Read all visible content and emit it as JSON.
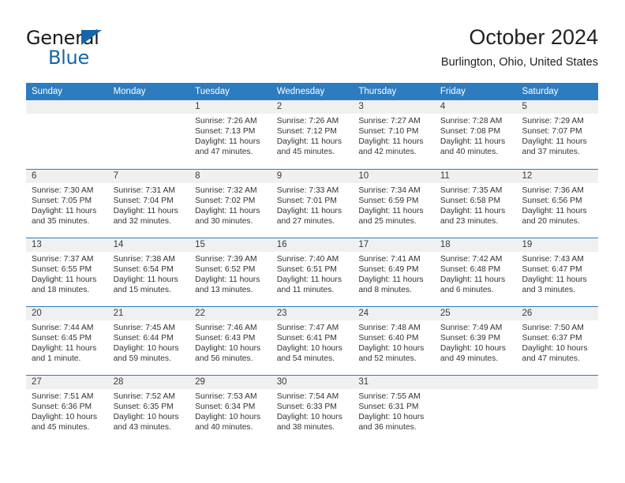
{
  "brand": {
    "name_part1": "General",
    "name_part2": "Blue",
    "triangle_color": "#1565aa"
  },
  "header": {
    "title": "October 2024",
    "subtitle": "Burlington, Ohio, United States"
  },
  "theme": {
    "header_blue": "#2d7cc0",
    "day_band_gray": "#f0f0f0",
    "text": "#333333"
  },
  "weekdays": [
    "Sunday",
    "Monday",
    "Tuesday",
    "Wednesday",
    "Thursday",
    "Friday",
    "Saturday"
  ],
  "labels": {
    "sunrise_prefix": "Sunrise: ",
    "sunset_prefix": "Sunset: ",
    "daylight_prefix": "Daylight: "
  },
  "weeks": [
    [
      {
        "day": "",
        "sunrise": "",
        "sunset": "",
        "daylight": "",
        "empty": true
      },
      {
        "day": "",
        "sunrise": "",
        "sunset": "",
        "daylight": "",
        "empty": true
      },
      {
        "day": "1",
        "sunrise": "Sunrise: 7:26 AM",
        "sunset": "Sunset: 7:13 PM",
        "daylight": "Daylight: 11 hours and 47 minutes."
      },
      {
        "day": "2",
        "sunrise": "Sunrise: 7:26 AM",
        "sunset": "Sunset: 7:12 PM",
        "daylight": "Daylight: 11 hours and 45 minutes."
      },
      {
        "day": "3",
        "sunrise": "Sunrise: 7:27 AM",
        "sunset": "Sunset: 7:10 PM",
        "daylight": "Daylight: 11 hours and 42 minutes."
      },
      {
        "day": "4",
        "sunrise": "Sunrise: 7:28 AM",
        "sunset": "Sunset: 7:08 PM",
        "daylight": "Daylight: 11 hours and 40 minutes."
      },
      {
        "day": "5",
        "sunrise": "Sunrise: 7:29 AM",
        "sunset": "Sunset: 7:07 PM",
        "daylight": "Daylight: 11 hours and 37 minutes."
      }
    ],
    [
      {
        "day": "6",
        "sunrise": "Sunrise: 7:30 AM",
        "sunset": "Sunset: 7:05 PM",
        "daylight": "Daylight: 11 hours and 35 minutes."
      },
      {
        "day": "7",
        "sunrise": "Sunrise: 7:31 AM",
        "sunset": "Sunset: 7:04 PM",
        "daylight": "Daylight: 11 hours and 32 minutes."
      },
      {
        "day": "8",
        "sunrise": "Sunrise: 7:32 AM",
        "sunset": "Sunset: 7:02 PM",
        "daylight": "Daylight: 11 hours and 30 minutes."
      },
      {
        "day": "9",
        "sunrise": "Sunrise: 7:33 AM",
        "sunset": "Sunset: 7:01 PM",
        "daylight": "Daylight: 11 hours and 27 minutes."
      },
      {
        "day": "10",
        "sunrise": "Sunrise: 7:34 AM",
        "sunset": "Sunset: 6:59 PM",
        "daylight": "Daylight: 11 hours and 25 minutes."
      },
      {
        "day": "11",
        "sunrise": "Sunrise: 7:35 AM",
        "sunset": "Sunset: 6:58 PM",
        "daylight": "Daylight: 11 hours and 23 minutes."
      },
      {
        "day": "12",
        "sunrise": "Sunrise: 7:36 AM",
        "sunset": "Sunset: 6:56 PM",
        "daylight": "Daylight: 11 hours and 20 minutes."
      }
    ],
    [
      {
        "day": "13",
        "sunrise": "Sunrise: 7:37 AM",
        "sunset": "Sunset: 6:55 PM",
        "daylight": "Daylight: 11 hours and 18 minutes."
      },
      {
        "day": "14",
        "sunrise": "Sunrise: 7:38 AM",
        "sunset": "Sunset: 6:54 PM",
        "daylight": "Daylight: 11 hours and 15 minutes."
      },
      {
        "day": "15",
        "sunrise": "Sunrise: 7:39 AM",
        "sunset": "Sunset: 6:52 PM",
        "daylight": "Daylight: 11 hours and 13 minutes."
      },
      {
        "day": "16",
        "sunrise": "Sunrise: 7:40 AM",
        "sunset": "Sunset: 6:51 PM",
        "daylight": "Daylight: 11 hours and 11 minutes."
      },
      {
        "day": "17",
        "sunrise": "Sunrise: 7:41 AM",
        "sunset": "Sunset: 6:49 PM",
        "daylight": "Daylight: 11 hours and 8 minutes."
      },
      {
        "day": "18",
        "sunrise": "Sunrise: 7:42 AM",
        "sunset": "Sunset: 6:48 PM",
        "daylight": "Daylight: 11 hours and 6 minutes."
      },
      {
        "day": "19",
        "sunrise": "Sunrise: 7:43 AM",
        "sunset": "Sunset: 6:47 PM",
        "daylight": "Daylight: 11 hours and 3 minutes."
      }
    ],
    [
      {
        "day": "20",
        "sunrise": "Sunrise: 7:44 AM",
        "sunset": "Sunset: 6:45 PM",
        "daylight": "Daylight: 11 hours and 1 minute."
      },
      {
        "day": "21",
        "sunrise": "Sunrise: 7:45 AM",
        "sunset": "Sunset: 6:44 PM",
        "daylight": "Daylight: 10 hours and 59 minutes."
      },
      {
        "day": "22",
        "sunrise": "Sunrise: 7:46 AM",
        "sunset": "Sunset: 6:43 PM",
        "daylight": "Daylight: 10 hours and 56 minutes."
      },
      {
        "day": "23",
        "sunrise": "Sunrise: 7:47 AM",
        "sunset": "Sunset: 6:41 PM",
        "daylight": "Daylight: 10 hours and 54 minutes."
      },
      {
        "day": "24",
        "sunrise": "Sunrise: 7:48 AM",
        "sunset": "Sunset: 6:40 PM",
        "daylight": "Daylight: 10 hours and 52 minutes."
      },
      {
        "day": "25",
        "sunrise": "Sunrise: 7:49 AM",
        "sunset": "Sunset: 6:39 PM",
        "daylight": "Daylight: 10 hours and 49 minutes."
      },
      {
        "day": "26",
        "sunrise": "Sunrise: 7:50 AM",
        "sunset": "Sunset: 6:37 PM",
        "daylight": "Daylight: 10 hours and 47 minutes."
      }
    ],
    [
      {
        "day": "27",
        "sunrise": "Sunrise: 7:51 AM",
        "sunset": "Sunset: 6:36 PM",
        "daylight": "Daylight: 10 hours and 45 minutes."
      },
      {
        "day": "28",
        "sunrise": "Sunrise: 7:52 AM",
        "sunset": "Sunset: 6:35 PM",
        "daylight": "Daylight: 10 hours and 43 minutes."
      },
      {
        "day": "29",
        "sunrise": "Sunrise: 7:53 AM",
        "sunset": "Sunset: 6:34 PM",
        "daylight": "Daylight: 10 hours and 40 minutes."
      },
      {
        "day": "30",
        "sunrise": "Sunrise: 7:54 AM",
        "sunset": "Sunset: 6:33 PM",
        "daylight": "Daylight: 10 hours and 38 minutes."
      },
      {
        "day": "31",
        "sunrise": "Sunrise: 7:55 AM",
        "sunset": "Sunset: 6:31 PM",
        "daylight": "Daylight: 10 hours and 36 minutes."
      },
      {
        "day": "",
        "sunrise": "",
        "sunset": "",
        "daylight": "",
        "empty": true
      },
      {
        "day": "",
        "sunrise": "",
        "sunset": "",
        "daylight": "",
        "empty": true
      }
    ]
  ]
}
